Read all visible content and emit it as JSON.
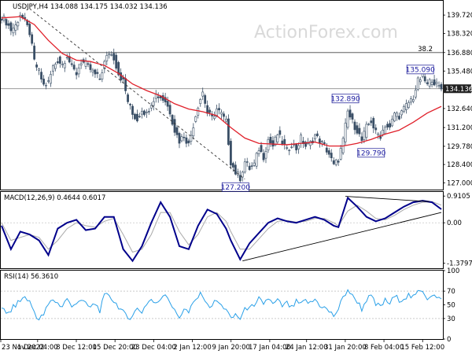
{
  "chart_data": {
    "type": "candlestick",
    "symbol_header": "USDJPY,H4  134.088 134.175 134.032 134.136",
    "watermark": "ActionForex.com",
    "price_panel": {
      "ylim": [
        126.5,
        140.8
      ],
      "y_ticks": [
        "139.720",
        "138.320",
        "136.880",
        "135.480",
        "134.040",
        "132.640",
        "131.200",
        "129.780",
        "128.400",
        "127.000"
      ],
      "current_price_label": "134.136",
      "fib_level": {
        "label": "38.2",
        "price": 136.88
      },
      "horizontal_line_price": 134.14,
      "close_path": [
        [
          0,
          139.6
        ],
        [
          2,
          139.2
        ],
        [
          4,
          138.6
        ],
        [
          6,
          138.9
        ],
        [
          8,
          139.8
        ],
        [
          10,
          139.2
        ],
        [
          12,
          138.4
        ],
        [
          14,
          136.2
        ],
        [
          16,
          135.4
        ],
        [
          18,
          134.4
        ],
        [
          20,
          134.6
        ],
        [
          22,
          135.8
        ],
        [
          24,
          136.3
        ],
        [
          26,
          136.0
        ],
        [
          28,
          136.7
        ],
        [
          30,
          135.7
        ],
        [
          32,
          135.3
        ],
        [
          34,
          136.2
        ],
        [
          36,
          136.0
        ],
        [
          38,
          135.6
        ],
        [
          40,
          135.2
        ],
        [
          42,
          134.9
        ],
        [
          44,
          136.1
        ],
        [
          46,
          136.9
        ],
        [
          48,
          136.5
        ],
        [
          50,
          135.3
        ],
        [
          52,
          134.7
        ],
        [
          54,
          133.2
        ],
        [
          56,
          132.2
        ],
        [
          58,
          131.8
        ],
        [
          60,
          132.6
        ],
        [
          62,
          132.2
        ],
        [
          64,
          133.1
        ],
        [
          66,
          133.7
        ],
        [
          68,
          133.5
        ],
        [
          70,
          133.2
        ],
        [
          72,
          132.4
        ],
        [
          74,
          131.0
        ],
        [
          76,
          130.2
        ],
        [
          78,
          130.6
        ],
        [
          80,
          129.9
        ],
        [
          82,
          131.4
        ],
        [
          84,
          132.9
        ],
        [
          86,
          133.9
        ],
        [
          88,
          132.3
        ],
        [
          90,
          131.9
        ],
        [
          92,
          132.6
        ],
        [
          94,
          132.2
        ],
        [
          96,
          131.6
        ],
        [
          98,
          128.6
        ],
        [
          100,
          127.8
        ],
        [
          102,
          127.4
        ],
        [
          104,
          128.6
        ],
        [
          106,
          128.1
        ],
        [
          108,
          128.4
        ],
        [
          110,
          129.6
        ],
        [
          112,
          129.0
        ],
        [
          114,
          130.3
        ],
        [
          116,
          129.8
        ],
        [
          118,
          130.7
        ],
        [
          120,
          130.1
        ],
        [
          122,
          129.4
        ],
        [
          124,
          130.0
        ],
        [
          126,
          129.6
        ],
        [
          128,
          130.4
        ],
        [
          130,
          129.8
        ],
        [
          132,
          130.0
        ],
        [
          134,
          130.6
        ],
        [
          136,
          130.2
        ],
        [
          138,
          129.8
        ],
        [
          140,
          129.2
        ],
        [
          142,
          128.3
        ],
        [
          144,
          128.8
        ],
        [
          146,
          130.2
        ],
        [
          148,
          132.4
        ],
        [
          150,
          131.6
        ],
        [
          152,
          131.0
        ],
        [
          154,
          130.2
        ],
        [
          156,
          131.2
        ],
        [
          158,
          131.7
        ],
        [
          160,
          130.8
        ],
        [
          162,
          130.6
        ],
        [
          164,
          131.4
        ],
        [
          166,
          131.1
        ],
        [
          168,
          132.3
        ],
        [
          170,
          132.1
        ],
        [
          172,
          132.6
        ],
        [
          174,
          133.1
        ],
        [
          176,
          133.5
        ],
        [
          178,
          134.7
        ],
        [
          180,
          135.09
        ],
        [
          182,
          134.4
        ],
        [
          184,
          134.9
        ],
        [
          186,
          134.4
        ],
        [
          188,
          134.14
        ]
      ],
      "ma_path": [
        [
          0,
          139.5
        ],
        [
          8,
          139.6
        ],
        [
          14,
          139.0
        ],
        [
          20,
          137.8
        ],
        [
          26,
          136.8
        ],
        [
          32,
          136.3
        ],
        [
          38,
          136.2
        ],
        [
          44,
          135.9
        ],
        [
          50,
          135.3
        ],
        [
          56,
          134.5
        ],
        [
          62,
          134.0
        ],
        [
          68,
          133.6
        ],
        [
          74,
          133.0
        ],
        [
          80,
          132.6
        ],
        [
          86,
          132.4
        ],
        [
          92,
          132.1
        ],
        [
          98,
          131.2
        ],
        [
          104,
          130.4
        ],
        [
          110,
          130.0
        ],
        [
          116,
          129.95
        ],
        [
          122,
          129.9
        ],
        [
          128,
          130.0
        ],
        [
          134,
          130.1
        ],
        [
          140,
          129.8
        ],
        [
          146,
          129.8
        ],
        [
          152,
          130.0
        ],
        [
          158,
          130.3
        ],
        [
          164,
          130.7
        ],
        [
          170,
          131.0
        ],
        [
          176,
          131.6
        ],
        [
          182,
          132.3
        ],
        [
          188,
          132.8
        ]
      ],
      "trendline": {
        "from": [
          12,
          140.2
        ],
        "to": [
          104,
          127.3
        ]
      },
      "annotations": [
        {
          "label": "127.200",
          "x": 101,
          "price": 127.2,
          "pos": "below"
        },
        {
          "label": "132.890",
          "x": 148,
          "price": 132.89,
          "pos": "above"
        },
        {
          "label": "129.790",
          "x": 159,
          "price": 129.79,
          "pos": "below"
        },
        {
          "label": "135.090",
          "x": 180,
          "price": 135.09,
          "pos": "above"
        }
      ]
    },
    "macd_panel": {
      "title": "MACD(12,26,9) 0.4644 0.6017",
      "ylim": [
        -1.55,
        1.05
      ],
      "y_ticks": [
        "0.9105",
        "0.00",
        "-1.3797"
      ],
      "macd_path": [
        [
          0,
          -0.1
        ],
        [
          4,
          -0.9
        ],
        [
          8,
          -0.3
        ],
        [
          12,
          -0.4
        ],
        [
          16,
          -0.6
        ],
        [
          20,
          -1.1
        ],
        [
          24,
          -0.2
        ],
        [
          28,
          0.0
        ],
        [
          32,
          0.1
        ],
        [
          36,
          -0.25
        ],
        [
          40,
          -0.2
        ],
        [
          44,
          0.2
        ],
        [
          48,
          0.2
        ],
        [
          52,
          -0.9
        ],
        [
          56,
          -1.3
        ],
        [
          60,
          -0.8
        ],
        [
          64,
          0.0
        ],
        [
          68,
          0.7
        ],
        [
          72,
          0.2
        ],
        [
          76,
          -0.8
        ],
        [
          80,
          -0.9
        ],
        [
          84,
          -0.1
        ],
        [
          88,
          0.45
        ],
        [
          92,
          0.3
        ],
        [
          96,
          -0.2
        ],
        [
          98,
          -0.6
        ],
        [
          102,
          -1.25
        ],
        [
          106,
          -0.7
        ],
        [
          110,
          -0.35
        ],
        [
          114,
          0.0
        ],
        [
          118,
          0.15
        ],
        [
          122,
          0.05
        ],
        [
          126,
          0.0
        ],
        [
          130,
          0.1
        ],
        [
          134,
          0.2
        ],
        [
          138,
          0.1
        ],
        [
          142,
          -0.1
        ],
        [
          144,
          -0.15
        ],
        [
          148,
          0.85
        ],
        [
          152,
          0.55
        ],
        [
          156,
          0.2
        ],
        [
          160,
          0.05
        ],
        [
          164,
          0.15
        ],
        [
          168,
          0.35
        ],
        [
          172,
          0.55
        ],
        [
          176,
          0.7
        ],
        [
          180,
          0.75
        ],
        [
          184,
          0.7
        ],
        [
          188,
          0.46
        ]
      ],
      "signal_path": [
        [
          0,
          0.0
        ],
        [
          4,
          -0.6
        ],
        [
          8,
          -0.5
        ],
        [
          12,
          -0.4
        ],
        [
          16,
          -0.5
        ],
        [
          20,
          -0.9
        ],
        [
          24,
          -0.6
        ],
        [
          28,
          -0.2
        ],
        [
          32,
          0.0
        ],
        [
          36,
          -0.1
        ],
        [
          40,
          -0.15
        ],
        [
          44,
          0.05
        ],
        [
          48,
          0.15
        ],
        [
          52,
          -0.4
        ],
        [
          56,
          -1.0
        ],
        [
          60,
          -0.9
        ],
        [
          64,
          -0.4
        ],
        [
          68,
          0.35
        ],
        [
          72,
          0.35
        ],
        [
          76,
          -0.3
        ],
        [
          80,
          -0.75
        ],
        [
          84,
          -0.4
        ],
        [
          88,
          0.2
        ],
        [
          92,
          0.35
        ],
        [
          96,
          0.05
        ],
        [
          98,
          -0.3
        ],
        [
          102,
          -0.9
        ],
        [
          106,
          -0.9
        ],
        [
          110,
          -0.55
        ],
        [
          114,
          -0.2
        ],
        [
          118,
          0.05
        ],
        [
          122,
          0.08
        ],
        [
          126,
          0.02
        ],
        [
          130,
          0.05
        ],
        [
          134,
          0.15
        ],
        [
          138,
          0.15
        ],
        [
          142,
          0.0
        ],
        [
          144,
          -0.1
        ],
        [
          148,
          0.4
        ],
        [
          152,
          0.6
        ],
        [
          156,
          0.4
        ],
        [
          160,
          0.15
        ],
        [
          164,
          0.1
        ],
        [
          168,
          0.25
        ],
        [
          172,
          0.45
        ],
        [
          176,
          0.6
        ],
        [
          180,
          0.7
        ],
        [
          184,
          0.72
        ],
        [
          188,
          0.6
        ]
      ],
      "trendlines": [
        {
          "from": [
            103,
            -1.3
          ],
          "to": [
            188,
            0.35
          ]
        },
        {
          "from": [
            147,
            0.9
          ],
          "to": [
            183,
            0.72
          ]
        }
      ]
    },
    "rsi_panel": {
      "title": "RSI(14) 56.3610",
      "ylim": [
        0,
        100
      ],
      "y_ticks": [
        "100",
        "70",
        "50",
        "30",
        "0"
      ],
      "levels": [
        70,
        30
      ],
      "rsi_path": [
        [
          0,
          48
        ],
        [
          2,
          35
        ],
        [
          4,
          42
        ],
        [
          6,
          50
        ],
        [
          8,
          56
        ],
        [
          10,
          62
        ],
        [
          12,
          54
        ],
        [
          14,
          40
        ],
        [
          16,
          28
        ],
        [
          18,
          36
        ],
        [
          20,
          50
        ],
        [
          22,
          58
        ],
        [
          24,
          52
        ],
        [
          26,
          48
        ],
        [
          28,
          60
        ],
        [
          30,
          45
        ],
        [
          32,
          55
        ],
        [
          34,
          58
        ],
        [
          36,
          50
        ],
        [
          38,
          46
        ],
        [
          40,
          52
        ],
        [
          42,
          42
        ],
        [
          44,
          62
        ],
        [
          46,
          65
        ],
        [
          48,
          55
        ],
        [
          50,
          48
        ],
        [
          52,
          38
        ],
        [
          54,
          30
        ],
        [
          56,
          36
        ],
        [
          58,
          44
        ],
        [
          60,
          40
        ],
        [
          62,
          52
        ],
        [
          64,
          58
        ],
        [
          66,
          50
        ],
        [
          68,
          60
        ],
        [
          70,
          68
        ],
        [
          72,
          55
        ],
        [
          74,
          40
        ],
        [
          76,
          32
        ],
        [
          78,
          45
        ],
        [
          80,
          38
        ],
        [
          82,
          52
        ],
        [
          84,
          62
        ],
        [
          86,
          66
        ],
        [
          88,
          48
        ],
        [
          90,
          50
        ],
        [
          92,
          56
        ],
        [
          94,
          48
        ],
        [
          96,
          45
        ],
        [
          98,
          28
        ],
        [
          100,
          36
        ],
        [
          102,
          30
        ],
        [
          104,
          42
        ],
        [
          106,
          50
        ],
        [
          108,
          44
        ],
        [
          110,
          58
        ],
        [
          112,
          52
        ],
        [
          114,
          60
        ],
        [
          116,
          50
        ],
        [
          118,
          56
        ],
        [
          120,
          48
        ],
        [
          122,
          52
        ],
        [
          124,
          45
        ],
        [
          126,
          54
        ],
        [
          128,
          50
        ],
        [
          130,
          56
        ],
        [
          132,
          52
        ],
        [
          134,
          58
        ],
        [
          136,
          50
        ],
        [
          138,
          46
        ],
        [
          140,
          40
        ],
        [
          142,
          34
        ],
        [
          144,
          44
        ],
        [
          146,
          60
        ],
        [
          148,
          73
        ],
        [
          150,
          62
        ],
        [
          152,
          56
        ],
        [
          154,
          44
        ],
        [
          156,
          58
        ],
        [
          158,
          62
        ],
        [
          160,
          50
        ],
        [
          162,
          48
        ],
        [
          164,
          56
        ],
        [
          166,
          52
        ],
        [
          168,
          62
        ],
        [
          170,
          58
        ],
        [
          172,
          60
        ],
        [
          174,
          64
        ],
        [
          176,
          60
        ],
        [
          178,
          68
        ],
        [
          180,
          72
        ],
        [
          182,
          60
        ],
        [
          184,
          66
        ],
        [
          186,
          60
        ],
        [
          188,
          56.36
        ]
      ]
    },
    "x_axis": {
      "labels": [
        "23 Nov 2022",
        "1 Dec 04:00",
        "8 Dec 12:00",
        "15 Dec 20:00",
        "23 Dec 04:00",
        "2 Jan 12:00",
        "9 Jan 20:00",
        "17 Jan 04:00",
        "24 Jan 12:00",
        "31 Jan 20:00",
        "8 Feb 04:00",
        "15 Feb 12:00"
      ],
      "label_bars": [
        0,
        20,
        41,
        62,
        83,
        104,
        125,
        146,
        166,
        187,
        208,
        229
      ],
      "total_bars": 240
    },
    "colors": {
      "candles": "#3a4f66",
      "ma": "#e0202a",
      "macd_line": "#00008b",
      "signal_line": "#a9a9a9",
      "rsi_line": "#2aa0e8",
      "trendline_dashed": "#333333",
      "trendline": "#000000",
      "annotation_box": "#2c2c9e",
      "current_price_bg": "#222222"
    }
  }
}
